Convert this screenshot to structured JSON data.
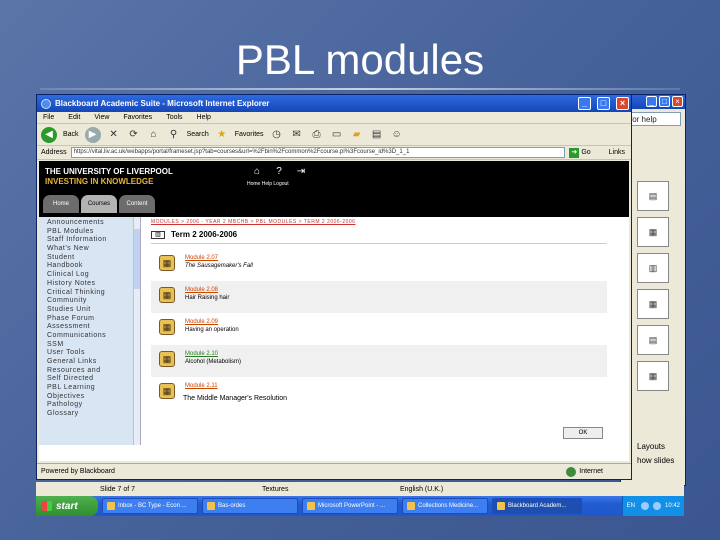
{
  "slide": {
    "title": "PBL modules"
  },
  "bg_window": {
    "help_text": "for help",
    "pane_label": "Layouts",
    "slides_label": "how slides"
  },
  "ie": {
    "title": "Blackboard Academic Suite - Microsoft Internet Explorer",
    "menu": [
      "File",
      "Edit",
      "View",
      "Favorites",
      "Tools",
      "Help"
    ],
    "toolbar": {
      "back_label": "Back",
      "search_label": "Search",
      "favorites_label": "Favorites"
    },
    "address_label": "Address",
    "address_value": "https://vital.liv.ac.uk/webapps/portal/frameset.jsp?tab=courses&url=%2Fbin%2Fcommon%2Fcourse.pl%3Fcourse_id%3D_1_1",
    "go_label": "Go",
    "links_label": "Links",
    "status_text": "Powered by Blackboard",
    "zone_text": "Internet"
  },
  "bb": {
    "uni_name": "THE UNIVERSITY OF LIVERPOOL",
    "uni_tag": "INVESTING IN KNOWLEDGE",
    "header_links": "Home Help Logout",
    "tabs": [
      "Home",
      "Courses",
      "Content"
    ],
    "nav_items": [
      "Announcements",
      "PBL Modules",
      "Staff Information",
      "What's New",
      "Student",
      "Handbook",
      "Clinical Log",
      "History Notes",
      "Critical Thinking",
      "Community",
      "Studies Unit",
      "Phase Forum",
      "Assessment",
      "Communications",
      "SSM",
      "User Tools",
      "General Links",
      "Resources and",
      "Self Directed",
      "PBL Learning",
      "Objectives",
      "Pathology",
      "Glossary"
    ],
    "breadcrumb": "MODULES > 2006 - YEAR 2 MBCHB > PBL MODULES > TERM 2 2006-2006",
    "term_title": "Term 2 2006-2006",
    "modules": [
      {
        "link": "Module 2.07",
        "sub": "The Sausagemaker's Fall"
      },
      {
        "link": "Module 2.08",
        "sub": "Hair Raising hair"
      },
      {
        "link": "Module 2.09",
        "sub": "Having an operation"
      },
      {
        "link": "Module 2.10",
        "sub": "Alcohol (Metabolism)"
      },
      {
        "link": "Module 2.11",
        "sub": ""
      }
    ],
    "module_note": "The Middle Manager's Resolution",
    "ok_label": "OK"
  },
  "ppt_status": {
    "slide_info": "Slide 7 of 7",
    "design": "Textures",
    "language": "English (U.K.)"
  },
  "taskbar": {
    "start_label": "start",
    "items": [
      "Inbox - BC Type - Econ ...",
      "Bas-ordes",
      "Microsoft PowerPoint - ...",
      "Collections Medicine...",
      "Blackboard Academ..."
    ],
    "active_index": 4,
    "lang": "EN",
    "clock": "10:42"
  }
}
